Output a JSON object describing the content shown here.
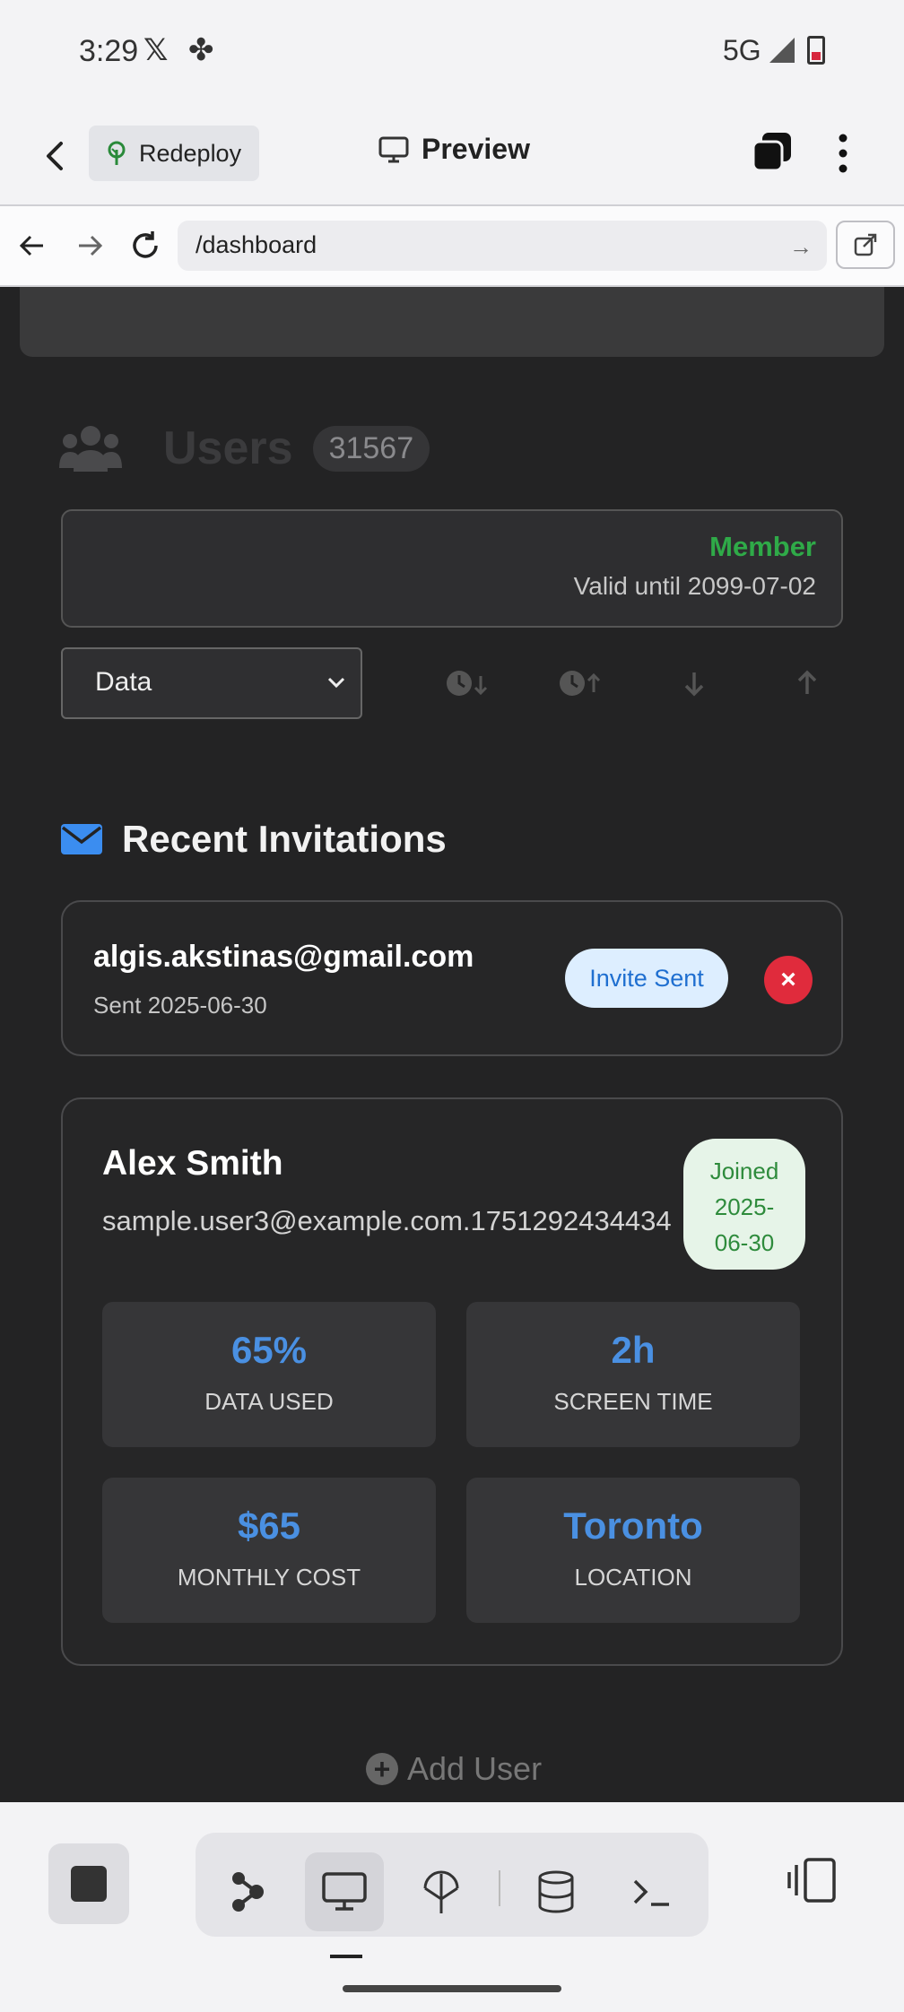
{
  "status_bar": {
    "time": "3:29",
    "network": "5G"
  },
  "app_header": {
    "redeploy_label": "Redeploy",
    "preview_label": "Preview"
  },
  "url_bar": {
    "url": "/dashboard"
  },
  "users": {
    "title": "Users",
    "count": "31567"
  },
  "membership": {
    "label": "Member",
    "valid_text": "Valid until 2099-07-02"
  },
  "filter": {
    "selected": "Data"
  },
  "invitations": {
    "title": "Recent Invitations",
    "items": [
      {
        "email": "algis.akstinas@gmail.com",
        "sent": "Sent 2025-06-30",
        "badge": "Invite Sent",
        "delete_symbol": "×"
      }
    ]
  },
  "user_card": {
    "name": "Alex Smith",
    "email": "sample.user3@example.com.1751292434434",
    "joined_lines": [
      "Joined",
      "2025-",
      "06-30"
    ],
    "stats": [
      {
        "value": "65%",
        "label": "DATA USED"
      },
      {
        "value": "2h",
        "label": "SCREEN TIME"
      },
      {
        "value": "$65",
        "label": "MONTHLY COST"
      },
      {
        "value": "Toronto",
        "label": "LOCATION"
      }
    ]
  },
  "add_user": {
    "label": "Add User"
  },
  "colors": {
    "accent_blue": "#4a90e2",
    "member_green": "#2faa48",
    "danger_red": "#e02b3c",
    "content_bg": "#232324"
  },
  "icons": [
    "back-arrow-icon",
    "tree-icon",
    "monitor-icon",
    "tabs-icon",
    "kebab-menu-icon",
    "arrow-left-icon",
    "arrow-right-icon",
    "reload-icon",
    "open-external-icon",
    "users-icon",
    "chevron-down-icon",
    "clock-down-icon",
    "clock-up-icon",
    "arrow-down-icon",
    "arrow-up-icon",
    "envelope-icon",
    "plus-circle-icon",
    "stop-icon",
    "graph-icon",
    "antenna-icon",
    "database-icon",
    "terminal-icon",
    "side-panel-icon"
  ]
}
